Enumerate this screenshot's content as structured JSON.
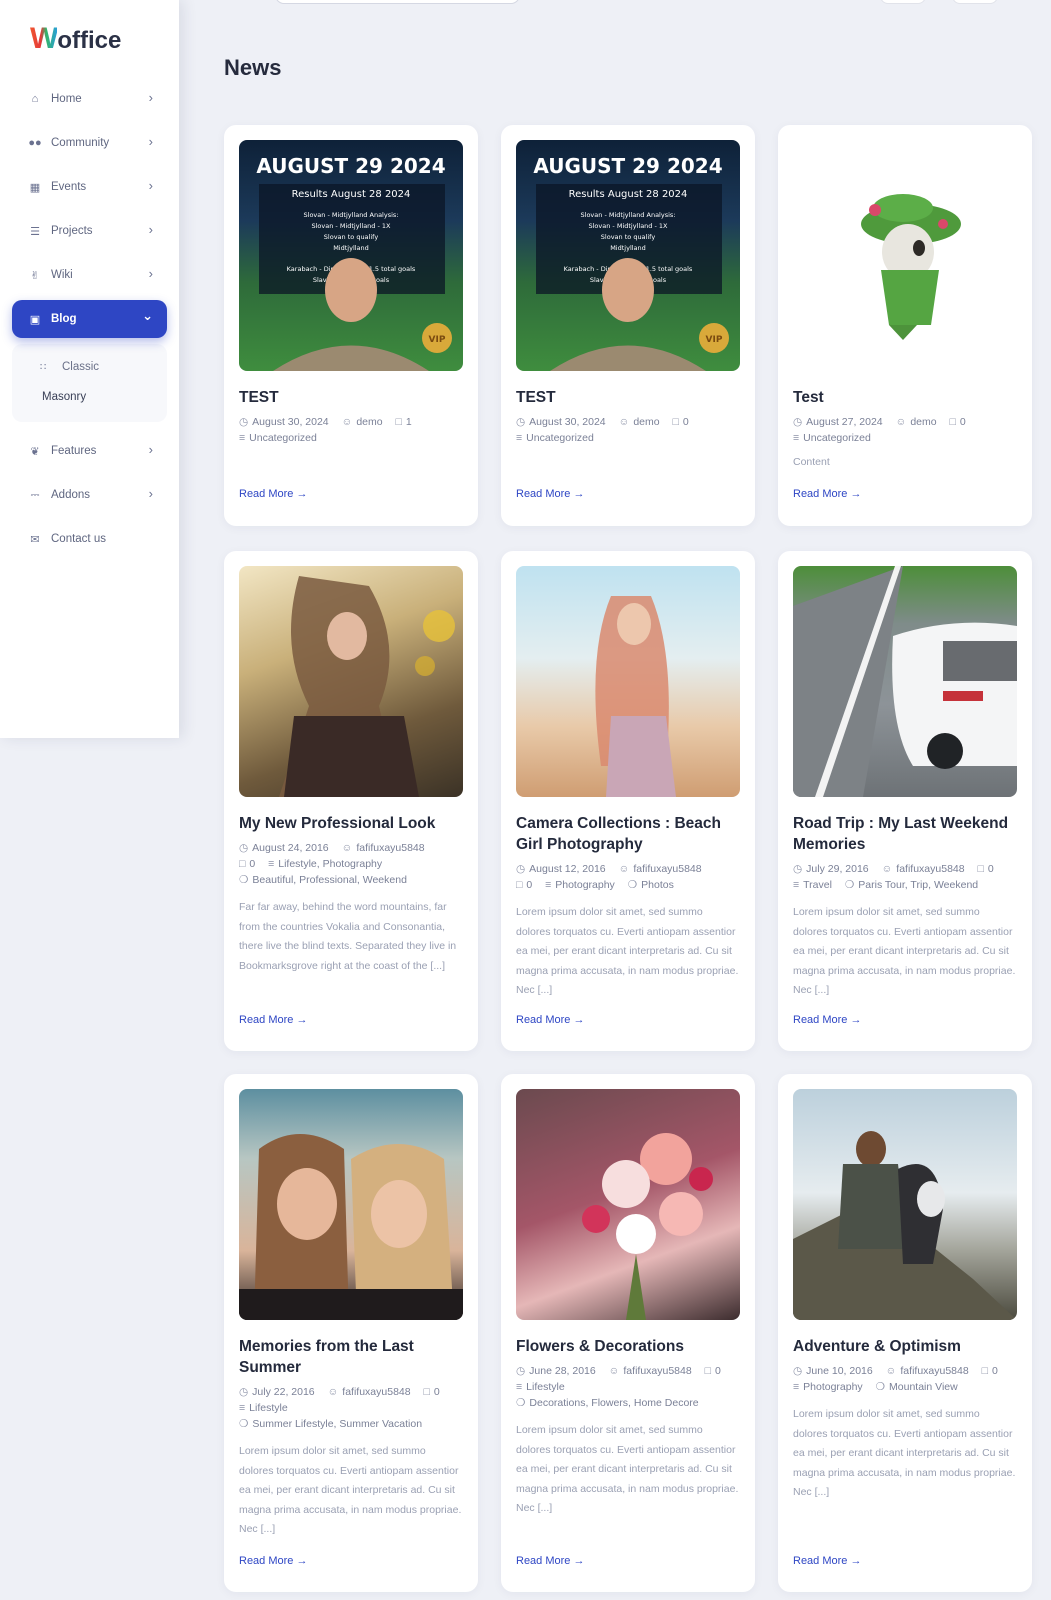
{
  "logo": {
    "w": "W",
    "rest": "office"
  },
  "sidebar": {
    "items": [
      {
        "label": "Home",
        "icon": "home-icon"
      },
      {
        "label": "Community",
        "icon": "users-icon"
      },
      {
        "label": "Events",
        "icon": "calendar-icon"
      },
      {
        "label": "Projects",
        "icon": "list-icon"
      },
      {
        "label": "Wiki",
        "icon": "hand-icon"
      },
      {
        "label": "Blog",
        "icon": "blog-icon"
      },
      {
        "label": "Features",
        "icon": "leaf-icon"
      },
      {
        "label": "Addons",
        "icon": "plug-icon"
      },
      {
        "label": "Contact us",
        "icon": "envelope-icon"
      }
    ],
    "blog_sub": [
      {
        "label": "Classic",
        "icon": "grid-icon"
      },
      {
        "label": "Masonry"
      }
    ]
  },
  "page": {
    "title": "News"
  },
  "posts": [
    {
      "title": "TEST",
      "date": "August 30, 2024",
      "author": "demo",
      "comments": "1",
      "categories": "Uncategorized",
      "tags": "",
      "excerpt": "",
      "read_more": "Read More"
    },
    {
      "title": "TEST",
      "date": "August 30, 2024",
      "author": "demo",
      "comments": "0",
      "categories": "Uncategorized",
      "tags": "",
      "excerpt": "",
      "read_more": "Read More"
    },
    {
      "title": "Test",
      "date": "August 27, 2024",
      "author": "demo",
      "comments": "0",
      "categories": "Uncategorized",
      "tags": "",
      "excerpt": "Content",
      "read_more": "Read More"
    },
    {
      "title": "My New Professional Look",
      "date": "August 24, 2016",
      "author": "fafifuxayu5848",
      "comments": "0",
      "categories": "Lifestyle, Photography",
      "tags": "Beautiful, Professional, Weekend",
      "excerpt": "Far far away, behind the word mountains, far from the countries Vokalia and Consonantia, there live the blind texts. Separated they live in Bookmarksgrove right at the coast of the [...]",
      "read_more": "Read More"
    },
    {
      "title": "Camera Collections : Beach Girl Photography",
      "date": "August 12, 2016",
      "author": "fafifuxayu5848",
      "comments": "0",
      "categories": "Photography",
      "tags": "Photos",
      "excerpt": "Lorem ipsum dolor sit amet, sed summo dolores torquatos cu. Everti antiopam assentior ea mei, per erant dicant interpretaris ad. Cu sit magna prima accusata, in nam modus propriae. Nec [...]",
      "read_more": "Read More"
    },
    {
      "title": "Road Trip : My Last Weekend Memories",
      "date": "July 29, 2016",
      "author": "fafifuxayu5848",
      "comments": "0",
      "categories": "Travel",
      "tags": "Paris Tour, Trip, Weekend",
      "excerpt": "Lorem ipsum dolor sit amet, sed summo dolores torquatos cu. Everti antiopam assentior ea mei, per erant dicant interpretaris ad. Cu sit magna prima accusata, in nam modus propriae. Nec [...]",
      "read_more": "Read More"
    },
    {
      "title": "Memories from the Last Summer",
      "date": "July 22, 2016",
      "author": "fafifuxayu5848",
      "comments": "0",
      "categories": "Lifestyle",
      "tags": "Summer Lifestyle, Summer Vacation",
      "excerpt": "Lorem ipsum dolor sit amet, sed summo dolores torquatos cu. Everti antiopam assentior ea mei, per erant dicant interpretaris ad. Cu sit magna prima accusata, in nam modus propriae. Nec [...]",
      "read_more": "Read More"
    },
    {
      "title": "Flowers & Decorations",
      "date": "June 28, 2016",
      "author": "fafifuxayu5848",
      "comments": "0",
      "categories": "Lifestyle",
      "tags": "Decorations, Flowers, Home Decore",
      "excerpt": "Lorem ipsum dolor sit amet, sed summo dolores torquatos cu. Everti antiopam assentior ea mei, per erant dicant interpretaris ad. Cu sit magna prima accusata, in nam modus propriae. Nec [...]",
      "read_more": "Read More"
    },
    {
      "title": "Adventure & Optimism",
      "date": "June 10, 2016",
      "author": "fafifuxayu5848",
      "comments": "0",
      "categories": "Photography",
      "tags": "Mountain View",
      "excerpt": "Lorem ipsum dolor sit amet, sed summo dolores torquatos cu. Everti antiopam assentior ea mei, per erant dicant interpretaris ad. Cu sit magna prima accusata, in nam modus propriae. Nec [...]",
      "read_more": "Read More"
    }
  ],
  "promo": {
    "headline": "AUGUST 29 2024",
    "sub": "Results August 28 2024",
    "lines": [
      "Slovan - Midtjylland Analysis:",
      "Slovan - Midtjylland - 1X",
      "Slovan to qualify",
      "Midtjylland",
      "Karabach - Dinamo Over 1.5 total goals",
      "Slavia - Lille 0.5+ goals"
    ],
    "badge": "VIP"
  }
}
